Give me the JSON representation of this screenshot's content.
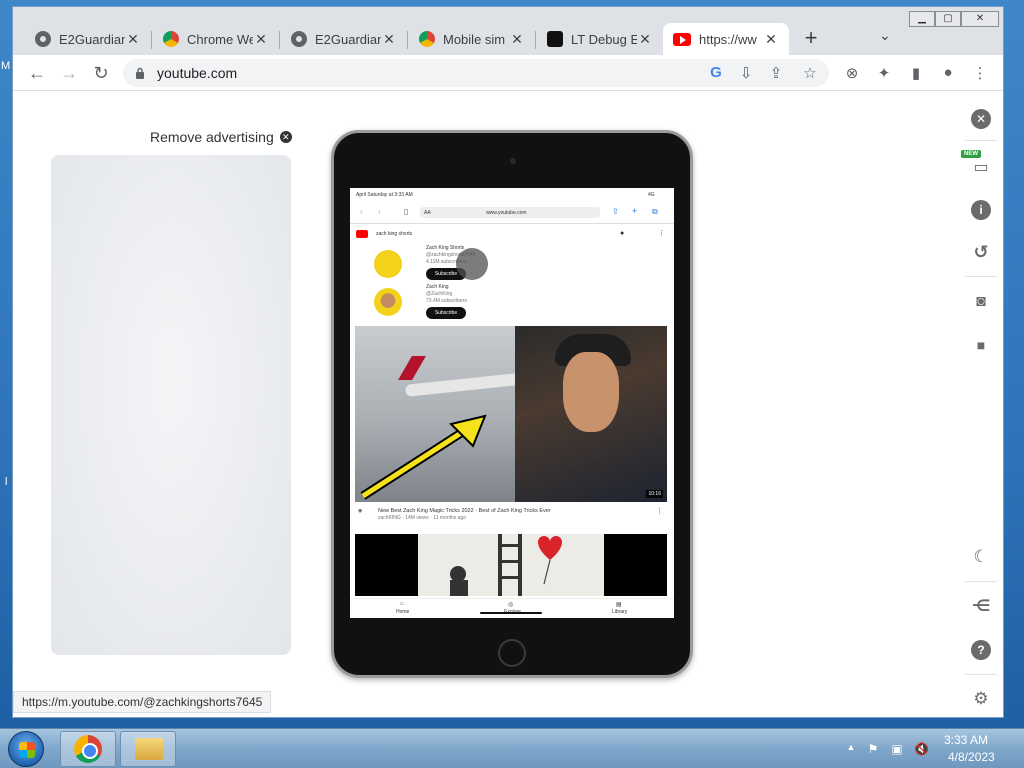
{
  "tabs": [
    {
      "title": "E2Guardian",
      "favicon": "globe-icon"
    },
    {
      "title": "Chrome We",
      "favicon": "chrome-webstore-icon"
    },
    {
      "title": "E2Guardian",
      "favicon": "globe-icon"
    },
    {
      "title": "Mobile sim",
      "favicon": "chrome-webstore-icon"
    },
    {
      "title": "LT Debug E",
      "favicon": "lt-debug-icon"
    },
    {
      "title": "https://ww",
      "favicon": "youtube-icon",
      "active": true
    }
  ],
  "tab_close_glyph": "✕",
  "new_tab_glyph": "+",
  "tab_search_glyph": "⌄",
  "window_controls": {
    "minimize": "▁",
    "maximize": "▢",
    "close": "✕"
  },
  "toolbar": {
    "back": "←",
    "forward": "→",
    "reload": "↻",
    "url": "youtube.com",
    "google_icon": "G",
    "install_icon": "⇩",
    "share_icon": "⇪",
    "bookmark_icon": "☆",
    "ext1": "⊗",
    "ext_puzzle": "✦",
    "sidepanel": "▮",
    "profile": "●",
    "menu": "⋮"
  },
  "content": {
    "remove_ad_label": "Remove advertising",
    "remove_ad_x": "✕"
  },
  "phone": {
    "status_time": "April Saturday at 3:33 AM",
    "status_right": "4G",
    "safari_aa": "AA",
    "safari_url": "www.youtube.com",
    "search_query": "zach king shorts",
    "channels": [
      {
        "name": "Zach King Shorts",
        "handle": "@zachkingshorts7645",
        "subs": "4.11M subscribers",
        "subscribe": "Subscribe"
      },
      {
        "name": "Zach King",
        "handle": "@ZachKing",
        "subs": "73.4M subscribers",
        "subscribe": "Subscribe"
      }
    ],
    "video1": {
      "duration": "10:16",
      "title": "New Best Zach King Magic Tricks 2022 - Best of Zach King Tricks Ever",
      "meta": "zachKING · 14M views · 11 months ago"
    },
    "nav": [
      "Home",
      "Explore",
      "Library"
    ]
  },
  "sidebar": {
    "close": "✕",
    "new_badge": "NEW",
    "devices": "▭",
    "info": "i",
    "rotate": "↺",
    "camera": "◙",
    "video": "■",
    "dark": "☾",
    "share": "⋲",
    "help": "?",
    "settings": "⚙"
  },
  "status_url": "https://m.youtube.com/@zachkingshorts7645",
  "taskbar": {
    "time": "3:33 AM",
    "date": "4/8/2023",
    "tray_arrow": "▲",
    "tray_flag": "⚑",
    "tray_network": "▣",
    "tray_volume": "🔇"
  }
}
